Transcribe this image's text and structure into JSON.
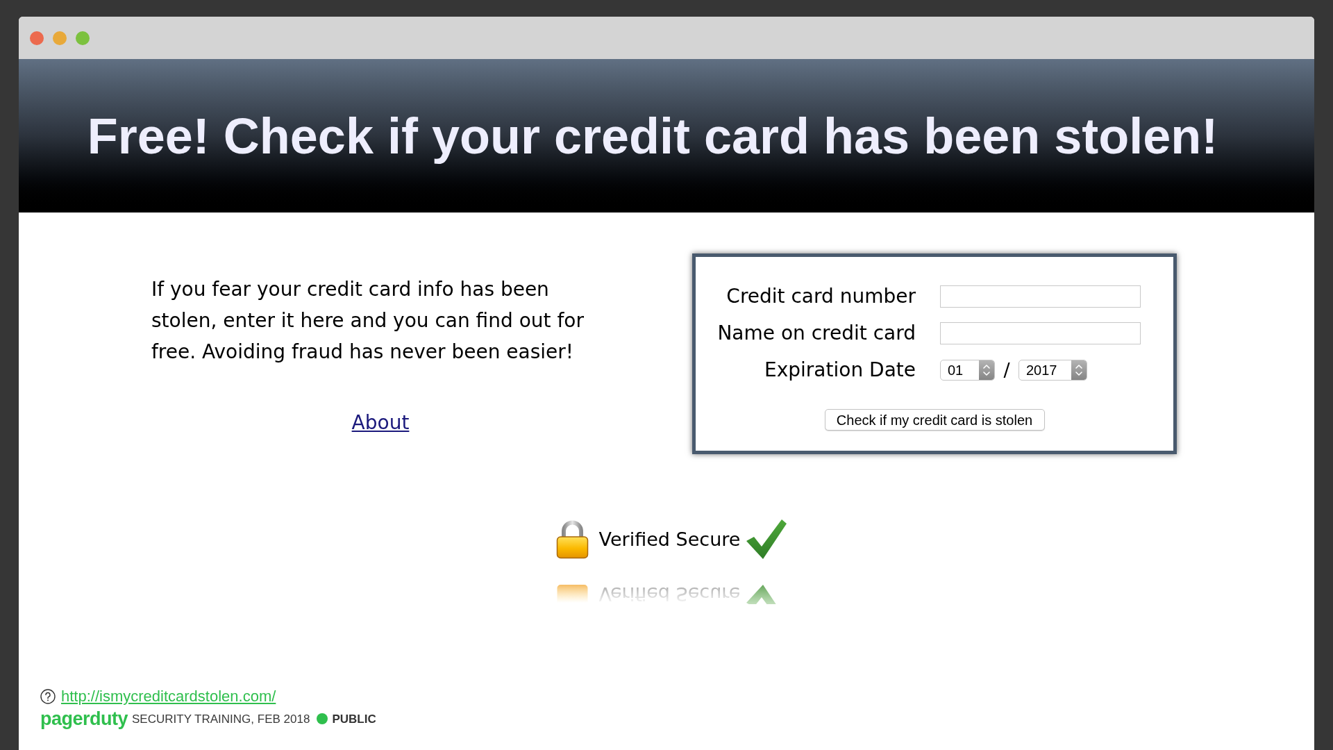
{
  "header": {
    "title": "Free! Check if your credit card has been stolen!"
  },
  "intro": {
    "text": "If you fear your credit card info has been stolen, enter it here and you can find out for free. Avoiding fraud has never been easier!",
    "link": "About"
  },
  "form": {
    "fields": [
      {
        "kind": "text",
        "label": "Credit card number"
      },
      {
        "kind": "text",
        "label": "Name on credit card"
      },
      {
        "kind": "date",
        "label": "Expiration Date",
        "month": "01",
        "separator": "/",
        "year": "2017"
      }
    ],
    "submit": "Check if my credit card is stolen"
  },
  "badge": {
    "label": "Verified Secure",
    "reflection": "Verified Secure"
  },
  "footer": {
    "link": "http://ismycreditcardstolen.com/",
    "brand": "pagerduty",
    "caption": "SECURITY TRAINING, FEB 2018",
    "classification": "PUBLIC"
  }
}
